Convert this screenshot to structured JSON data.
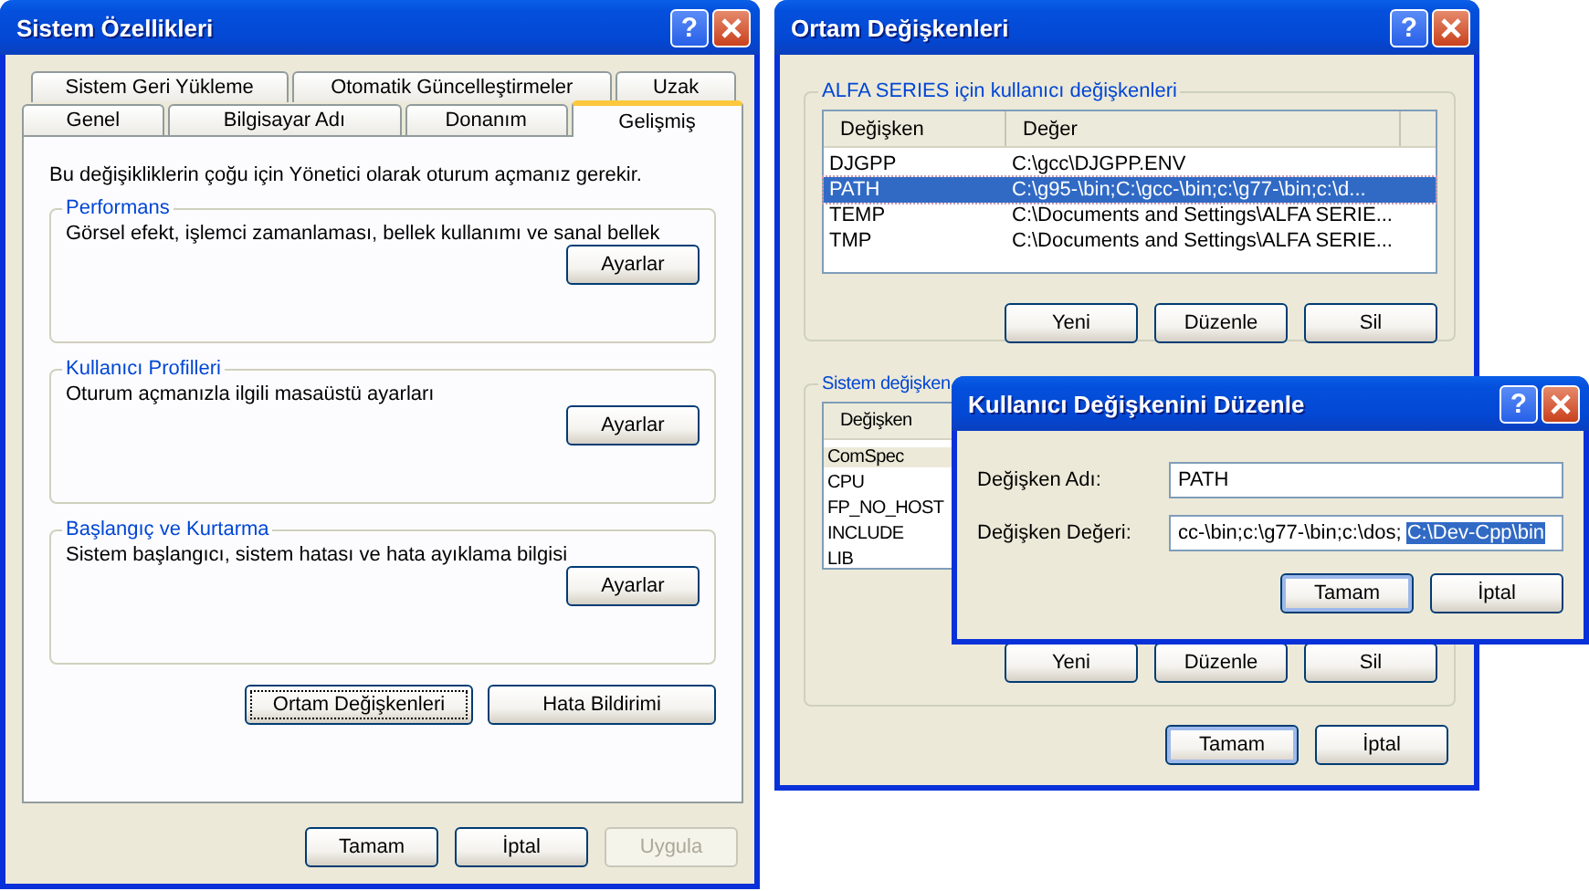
{
  "system_properties": {
    "title": "Sistem Özellikleri",
    "help_label": "?",
    "tab_rows": [
      [
        {
          "label": "Sistem Geri Yükleme",
          "selected": false
        },
        {
          "label": "Otomatik Güncelleştirmeler",
          "selected": false
        },
        {
          "label": "Uzak",
          "selected": false
        }
      ],
      [
        {
          "label": "Genel",
          "selected": false
        },
        {
          "label": "Bilgisayar Adı",
          "selected": false
        },
        {
          "label": "Donanım",
          "selected": false
        },
        {
          "label": "Gelişmiş",
          "selected": true
        }
      ]
    ],
    "intro": "Bu değişikliklerin çoğu için Yönetici olarak oturum açmanız gerekir.",
    "groups": [
      {
        "title": "Performans",
        "text": "Görsel efekt, işlemci zamanlaması, bellek kullanımı ve sanal bellek",
        "button": "Ayarlar"
      },
      {
        "title": "Kullanıcı Profilleri",
        "text": "Oturum açmanızla ilgili masaüstü ayarları",
        "button": "Ayarlar"
      },
      {
        "title": "Başlangıç ve Kurtarma",
        "text": "Sistem başlangıcı, sistem hatası ve hata ayıklama bilgisi",
        "button": "Ayarlar"
      }
    ],
    "panel_buttons": [
      {
        "label": "Ortam Değişkenleri",
        "focused": true
      },
      {
        "label": "Hata Bildirimi",
        "focused": false
      }
    ],
    "buttons": [
      {
        "label": "Tamam",
        "disabled": false
      },
      {
        "label": "İptal",
        "disabled": false
      },
      {
        "label": "Uygula",
        "disabled": true
      }
    ]
  },
  "environment_variables": {
    "title": "Ortam Değişkenleri",
    "help_label": "?",
    "user_group": {
      "title": "ALFA SERIES için kullanıcı değişkenleri",
      "active": true,
      "columns": [
        "Değişken",
        "Değer"
      ],
      "rows": [
        {
          "name": "DJGPP",
          "value": "C:\\gcc\\DJGPP.ENV",
          "selected": false
        },
        {
          "name": "PATH",
          "value": "C:\\g95-\\bin;C:\\gcc-\\bin;c:\\g77-\\bin;c:\\d...",
          "selected": true
        },
        {
          "name": "TEMP",
          "value": "C:\\Documents and Settings\\ALFA SERIE...",
          "selected": false
        },
        {
          "name": "TMP",
          "value": "C:\\Documents and Settings\\ALFA SERIE...",
          "selected": false
        }
      ],
      "buttons": [
        "Yeni",
        "Düzenle",
        "Sil"
      ]
    },
    "system_group": {
      "title": "Sistem değişken",
      "active": false,
      "columns": [
        "Değişken"
      ],
      "rows": [
        {
          "name": "ComSpec",
          "selected": true
        },
        {
          "name": "CPU",
          "selected": false
        },
        {
          "name": "FP_NO_HOST",
          "selected": false
        },
        {
          "name": "INCLUDE",
          "selected": false
        },
        {
          "name": "LIB",
          "selected": false
        }
      ],
      "buttons": [
        "Yeni",
        "Düzenle",
        "Sil"
      ]
    },
    "buttons": [
      {
        "label": "Tamam",
        "default": true
      },
      {
        "label": "İptal",
        "default": false
      }
    ]
  },
  "edit_user_variable": {
    "title": "Kullanıcı Değişkenini Düzenle",
    "help_label": "?",
    "fields": [
      {
        "label": "Değişken Adı:",
        "value": "PATH"
      },
      {
        "label": "Değişken Değeri:",
        "value": "cc-\\bin;c:\\g77-\\bin;c:\\dos; ",
        "selected_value": "C:\\Dev-Cpp\\bin"
      }
    ],
    "buttons": [
      {
        "label": "Tamam",
        "default": true
      },
      {
        "label": "İptal",
        "default": false
      }
    ]
  }
}
